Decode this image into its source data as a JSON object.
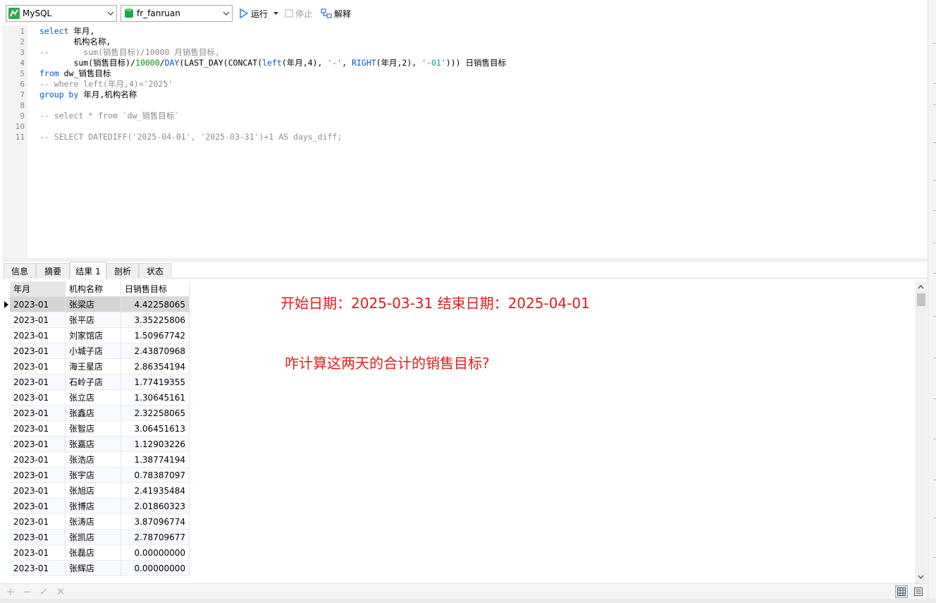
{
  "toolbar": {
    "connection": "MySQL",
    "database": "fr_fanruan",
    "run_label": "运行",
    "stop_label": "停止",
    "explain_label": "解释"
  },
  "editor": {
    "line_numbers": [
      "1",
      "2",
      "3",
      "4",
      "5",
      "6",
      "7",
      "8",
      "9",
      "10",
      "11"
    ],
    "lines": {
      "l1_kw": "select",
      "l1_rest": " 年月,",
      "l2": "       机构名称,",
      "l3": "--       sum(销售目标)/10000 月销售目标,",
      "l4_a": "       sum(销售目标)/",
      "l4_num": "10000",
      "l4_b": "/",
      "l4_day": "DAY",
      "l4_c": "(LAST_DAY(CONCAT(",
      "l4_left": "left",
      "l4_d": "(年月,4), ",
      "l4_s1": "'-'",
      "l4_e": ", ",
      "l4_right": "RIGHT",
      "l4_f": "(年月,2), ",
      "l4_s2": "'-01'",
      "l4_g": "))) 日销售目标",
      "l5_kw": "from",
      "l5_rest": " dw_销售目标",
      "l6": "-- where left(年月,4)='2025'",
      "l7_kw": "group by",
      "l7_rest": " 年月,机构名称",
      "l8": "",
      "l9": "-- select * from `dw_销售目标`",
      "l10": "",
      "l11": "-- SELECT DATEDIFF('2025-04-01', '2025-03-31')+1 AS days_diff;"
    }
  },
  "tabs": [
    "信息",
    "摘要",
    "结果 1",
    "剖析",
    "状态"
  ],
  "grid": {
    "columns": [
      "年月",
      "机构名称",
      "日销售目标"
    ],
    "rows": [
      [
        "2023-01",
        "张梁店",
        "4.42258065"
      ],
      [
        "2023-01",
        "张平店",
        "3.35225806"
      ],
      [
        "2023-01",
        "刘家馆店",
        "1.50967742"
      ],
      [
        "2023-01",
        "小城子店",
        "2.43870968"
      ],
      [
        "2023-01",
        "海王星店",
        "2.86354194"
      ],
      [
        "2023-01",
        "石岭子店",
        "1.77419355"
      ],
      [
        "2023-01",
        "张立店",
        "1.30645161"
      ],
      [
        "2023-01",
        "张鑫店",
        "2.32258065"
      ],
      [
        "2023-01",
        "张智店",
        "3.06451613"
      ],
      [
        "2023-01",
        "张嘉店",
        "1.12903226"
      ],
      [
        "2023-01",
        "张浩店",
        "1.38774194"
      ],
      [
        "2023-01",
        "张宇店",
        "0.78387097"
      ],
      [
        "2023-01",
        "张旭店",
        "2.41935484"
      ],
      [
        "2023-01",
        "张博店",
        "2.01860323"
      ],
      [
        "2023-01",
        "张涛店",
        "3.87096774"
      ],
      [
        "2023-01",
        "张凯店",
        "2.78709677"
      ],
      [
        "2023-01",
        "张磊店",
        "0.00000000"
      ],
      [
        "2023-01",
        "张辉店",
        "0.00000000"
      ]
    ]
  },
  "annotations": {
    "dates": "开始日期：2025-03-31    结束日期：2025-04-01",
    "question": "咋计算这两天的合计的销售目标?"
  },
  "colors": {
    "accent_red": "#e11b1b",
    "keyword_blue": "#0055cc",
    "comment_gray": "#8c8c8c"
  }
}
